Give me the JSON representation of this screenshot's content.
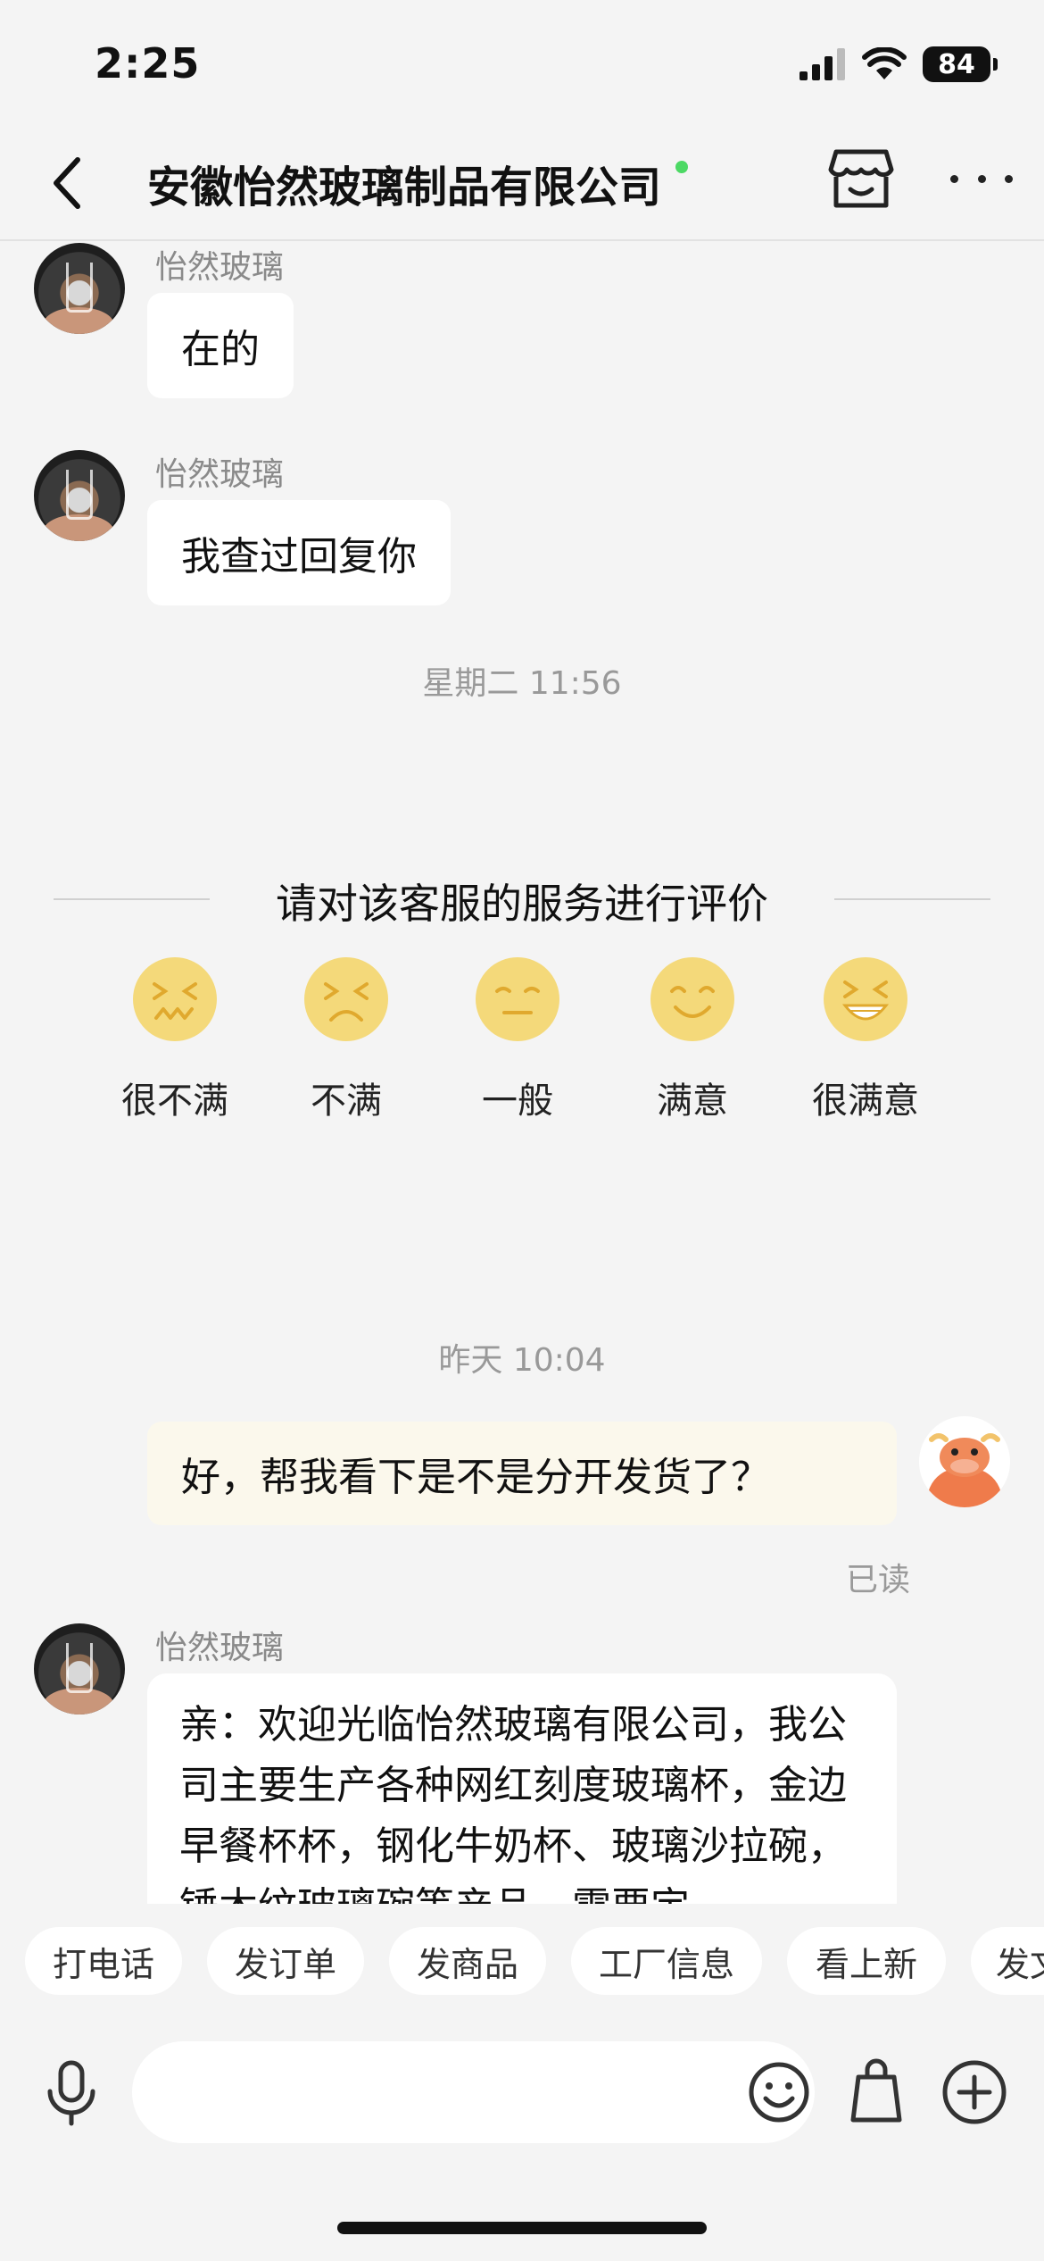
{
  "status_bar": {
    "time": "2:25",
    "battery": "84"
  },
  "nav": {
    "title": "安徽怡然玻璃制品有限公司"
  },
  "messages": [
    {
      "sender": "怡然玻璃",
      "text": "在的"
    },
    {
      "sender": "怡然玻璃",
      "text": "我查过回复你"
    }
  ],
  "timestamp_1": "星期二 11:56",
  "rating": {
    "title": "请对该客服的服务进行评价",
    "options": [
      "很不满",
      "不满",
      "一般",
      "满意",
      "很满意"
    ]
  },
  "timestamp_2": "昨天 10:04",
  "my_message": {
    "text": "好，帮我看下是不是分开发货了？",
    "read_status": "已读"
  },
  "long_message": {
    "sender": "怡然玻璃",
    "text": "亲：欢迎光临怡然玻璃有限公司，我公司主要生产各种网红刻度玻璃杯，金边早餐杯杯，钢化牛奶杯、玻璃沙拉碗，锤木纹玻璃碗等产品，需要定"
  },
  "quick_replies": [
    "打电话",
    "发订单",
    "发商品",
    "工厂信息",
    "看上新",
    "发文"
  ],
  "input": {
    "placeholder": ""
  },
  "colors": {
    "background": "#f4f4f4",
    "my_bubble": "#fbf8ec",
    "online": "#4cd964",
    "face": "#f4d97a"
  }
}
